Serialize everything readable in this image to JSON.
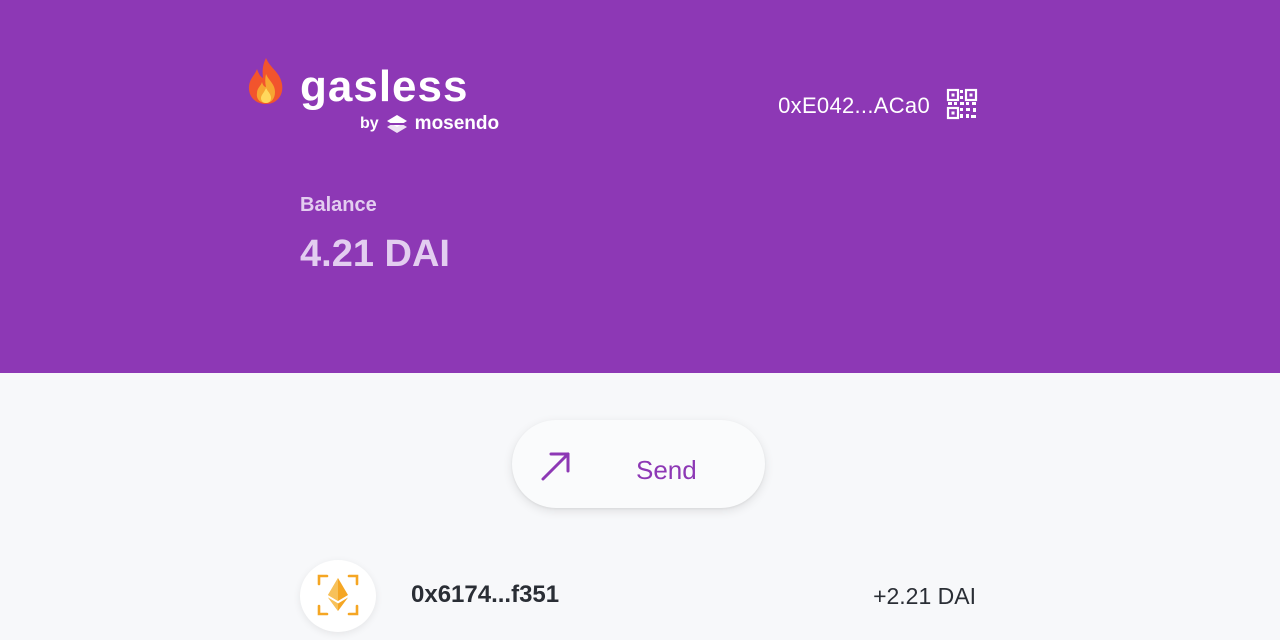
{
  "header": {
    "brand": "gasless",
    "by": "by",
    "partner": "mosendo",
    "address": "0xE042...ACa0",
    "icons": {
      "logo": "flame-icon",
      "partner_logo": "mosendo-logo-icon",
      "qr": "qr-code-icon"
    }
  },
  "balance": {
    "label": "Balance",
    "value": "4.21 DAI"
  },
  "actions": {
    "send_label": "Send",
    "send_icon": "arrow-up-right-icon"
  },
  "transactions": [
    {
      "address": "0x6174...f351",
      "amount": "+2.21 DAI",
      "icon": "ethereum-icon"
    }
  ],
  "colors": {
    "brand_purple": "#8d38b5",
    "balance_text": "#e3cdf0",
    "page_background": "#f7f8fa",
    "ethereum_gold": "#f5a623"
  }
}
